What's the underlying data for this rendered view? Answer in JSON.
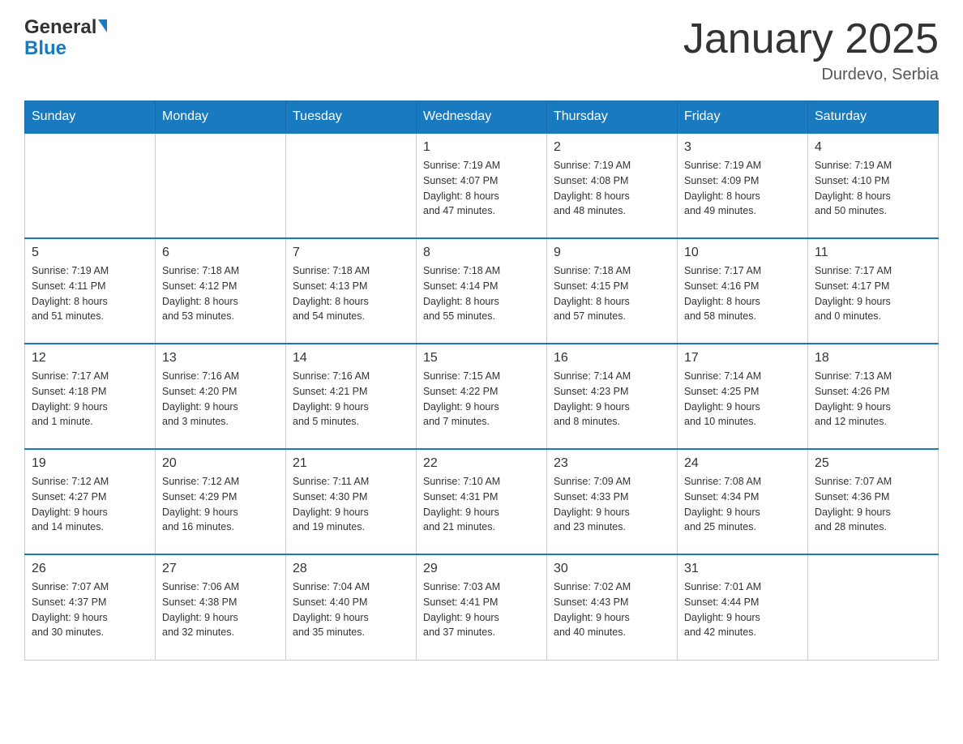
{
  "header": {
    "logo": {
      "general": "General",
      "blue": "Blue"
    },
    "title": "January 2025",
    "subtitle": "Durdevo, Serbia"
  },
  "weekdays": [
    "Sunday",
    "Monday",
    "Tuesday",
    "Wednesday",
    "Thursday",
    "Friday",
    "Saturday"
  ],
  "weeks": [
    [
      {
        "day": "",
        "info": ""
      },
      {
        "day": "",
        "info": ""
      },
      {
        "day": "",
        "info": ""
      },
      {
        "day": "1",
        "info": "Sunrise: 7:19 AM\nSunset: 4:07 PM\nDaylight: 8 hours\nand 47 minutes."
      },
      {
        "day": "2",
        "info": "Sunrise: 7:19 AM\nSunset: 4:08 PM\nDaylight: 8 hours\nand 48 minutes."
      },
      {
        "day": "3",
        "info": "Sunrise: 7:19 AM\nSunset: 4:09 PM\nDaylight: 8 hours\nand 49 minutes."
      },
      {
        "day": "4",
        "info": "Sunrise: 7:19 AM\nSunset: 4:10 PM\nDaylight: 8 hours\nand 50 minutes."
      }
    ],
    [
      {
        "day": "5",
        "info": "Sunrise: 7:19 AM\nSunset: 4:11 PM\nDaylight: 8 hours\nand 51 minutes."
      },
      {
        "day": "6",
        "info": "Sunrise: 7:18 AM\nSunset: 4:12 PM\nDaylight: 8 hours\nand 53 minutes."
      },
      {
        "day": "7",
        "info": "Sunrise: 7:18 AM\nSunset: 4:13 PM\nDaylight: 8 hours\nand 54 minutes."
      },
      {
        "day": "8",
        "info": "Sunrise: 7:18 AM\nSunset: 4:14 PM\nDaylight: 8 hours\nand 55 minutes."
      },
      {
        "day": "9",
        "info": "Sunrise: 7:18 AM\nSunset: 4:15 PM\nDaylight: 8 hours\nand 57 minutes."
      },
      {
        "day": "10",
        "info": "Sunrise: 7:17 AM\nSunset: 4:16 PM\nDaylight: 8 hours\nand 58 minutes."
      },
      {
        "day": "11",
        "info": "Sunrise: 7:17 AM\nSunset: 4:17 PM\nDaylight: 9 hours\nand 0 minutes."
      }
    ],
    [
      {
        "day": "12",
        "info": "Sunrise: 7:17 AM\nSunset: 4:18 PM\nDaylight: 9 hours\nand 1 minute."
      },
      {
        "day": "13",
        "info": "Sunrise: 7:16 AM\nSunset: 4:20 PM\nDaylight: 9 hours\nand 3 minutes."
      },
      {
        "day": "14",
        "info": "Sunrise: 7:16 AM\nSunset: 4:21 PM\nDaylight: 9 hours\nand 5 minutes."
      },
      {
        "day": "15",
        "info": "Sunrise: 7:15 AM\nSunset: 4:22 PM\nDaylight: 9 hours\nand 7 minutes."
      },
      {
        "day": "16",
        "info": "Sunrise: 7:14 AM\nSunset: 4:23 PM\nDaylight: 9 hours\nand 8 minutes."
      },
      {
        "day": "17",
        "info": "Sunrise: 7:14 AM\nSunset: 4:25 PM\nDaylight: 9 hours\nand 10 minutes."
      },
      {
        "day": "18",
        "info": "Sunrise: 7:13 AM\nSunset: 4:26 PM\nDaylight: 9 hours\nand 12 minutes."
      }
    ],
    [
      {
        "day": "19",
        "info": "Sunrise: 7:12 AM\nSunset: 4:27 PM\nDaylight: 9 hours\nand 14 minutes."
      },
      {
        "day": "20",
        "info": "Sunrise: 7:12 AM\nSunset: 4:29 PM\nDaylight: 9 hours\nand 16 minutes."
      },
      {
        "day": "21",
        "info": "Sunrise: 7:11 AM\nSunset: 4:30 PM\nDaylight: 9 hours\nand 19 minutes."
      },
      {
        "day": "22",
        "info": "Sunrise: 7:10 AM\nSunset: 4:31 PM\nDaylight: 9 hours\nand 21 minutes."
      },
      {
        "day": "23",
        "info": "Sunrise: 7:09 AM\nSunset: 4:33 PM\nDaylight: 9 hours\nand 23 minutes."
      },
      {
        "day": "24",
        "info": "Sunrise: 7:08 AM\nSunset: 4:34 PM\nDaylight: 9 hours\nand 25 minutes."
      },
      {
        "day": "25",
        "info": "Sunrise: 7:07 AM\nSunset: 4:36 PM\nDaylight: 9 hours\nand 28 minutes."
      }
    ],
    [
      {
        "day": "26",
        "info": "Sunrise: 7:07 AM\nSunset: 4:37 PM\nDaylight: 9 hours\nand 30 minutes."
      },
      {
        "day": "27",
        "info": "Sunrise: 7:06 AM\nSunset: 4:38 PM\nDaylight: 9 hours\nand 32 minutes."
      },
      {
        "day": "28",
        "info": "Sunrise: 7:04 AM\nSunset: 4:40 PM\nDaylight: 9 hours\nand 35 minutes."
      },
      {
        "day": "29",
        "info": "Sunrise: 7:03 AM\nSunset: 4:41 PM\nDaylight: 9 hours\nand 37 minutes."
      },
      {
        "day": "30",
        "info": "Sunrise: 7:02 AM\nSunset: 4:43 PM\nDaylight: 9 hours\nand 40 minutes."
      },
      {
        "day": "31",
        "info": "Sunrise: 7:01 AM\nSunset: 4:44 PM\nDaylight: 9 hours\nand 42 minutes."
      },
      {
        "day": "",
        "info": ""
      }
    ]
  ]
}
